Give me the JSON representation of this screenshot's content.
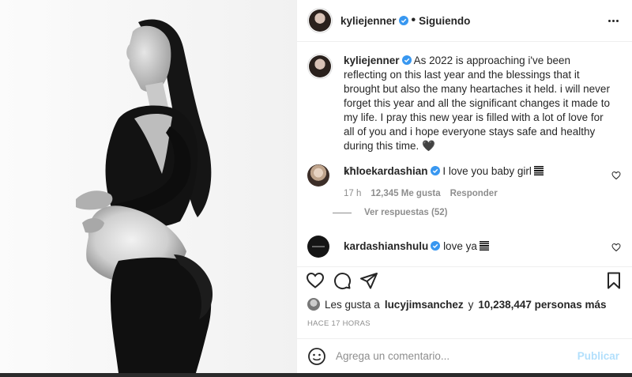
{
  "header": {
    "username": "kyliejenner",
    "separator": "•",
    "follow_label": "Siguiendo",
    "verified_icon": "verified-badge-icon",
    "more_icon": "more-options-icon"
  },
  "caption": {
    "username": "kyliejenner",
    "text": "As 2022 is approaching i've been reflecting on this last year and the blessings that it brought but also the many heartaches it held. i will never forget this year and all the significant changes it made to my life. I pray this new year is filled with a lot of love for all of you and i hope everyone stays safe and healthy during this time. 🖤",
    "time": "17 h"
  },
  "comments": [
    {
      "username": "khloekardashian",
      "text": "I love you baby girl",
      "time": "17 h",
      "likes": "12,345 Me gusta",
      "reply_label": "Responder",
      "view_replies": "Ver respuestas (52)"
    },
    {
      "username": "kardashianshulu",
      "text": "love ya"
    }
  ],
  "actions": {
    "icons": [
      "heart-icon",
      "comment-icon",
      "share-icon",
      "bookmark-icon"
    ]
  },
  "likes": {
    "prefix": "Les gusta a",
    "user": "lucyjimsanchez",
    "conjunction": "y",
    "count": "10,238,447 personas más"
  },
  "posted": "HACE 17 HORAS",
  "add_comment": {
    "placeholder": "Agrega un comentario...",
    "publish_label": "Publicar",
    "emoji_icon": "emoji-icon"
  },
  "colors": {
    "verified": "#3897f0",
    "publish_disabled": "#b2dffc",
    "muted": "#8e8e8e"
  }
}
